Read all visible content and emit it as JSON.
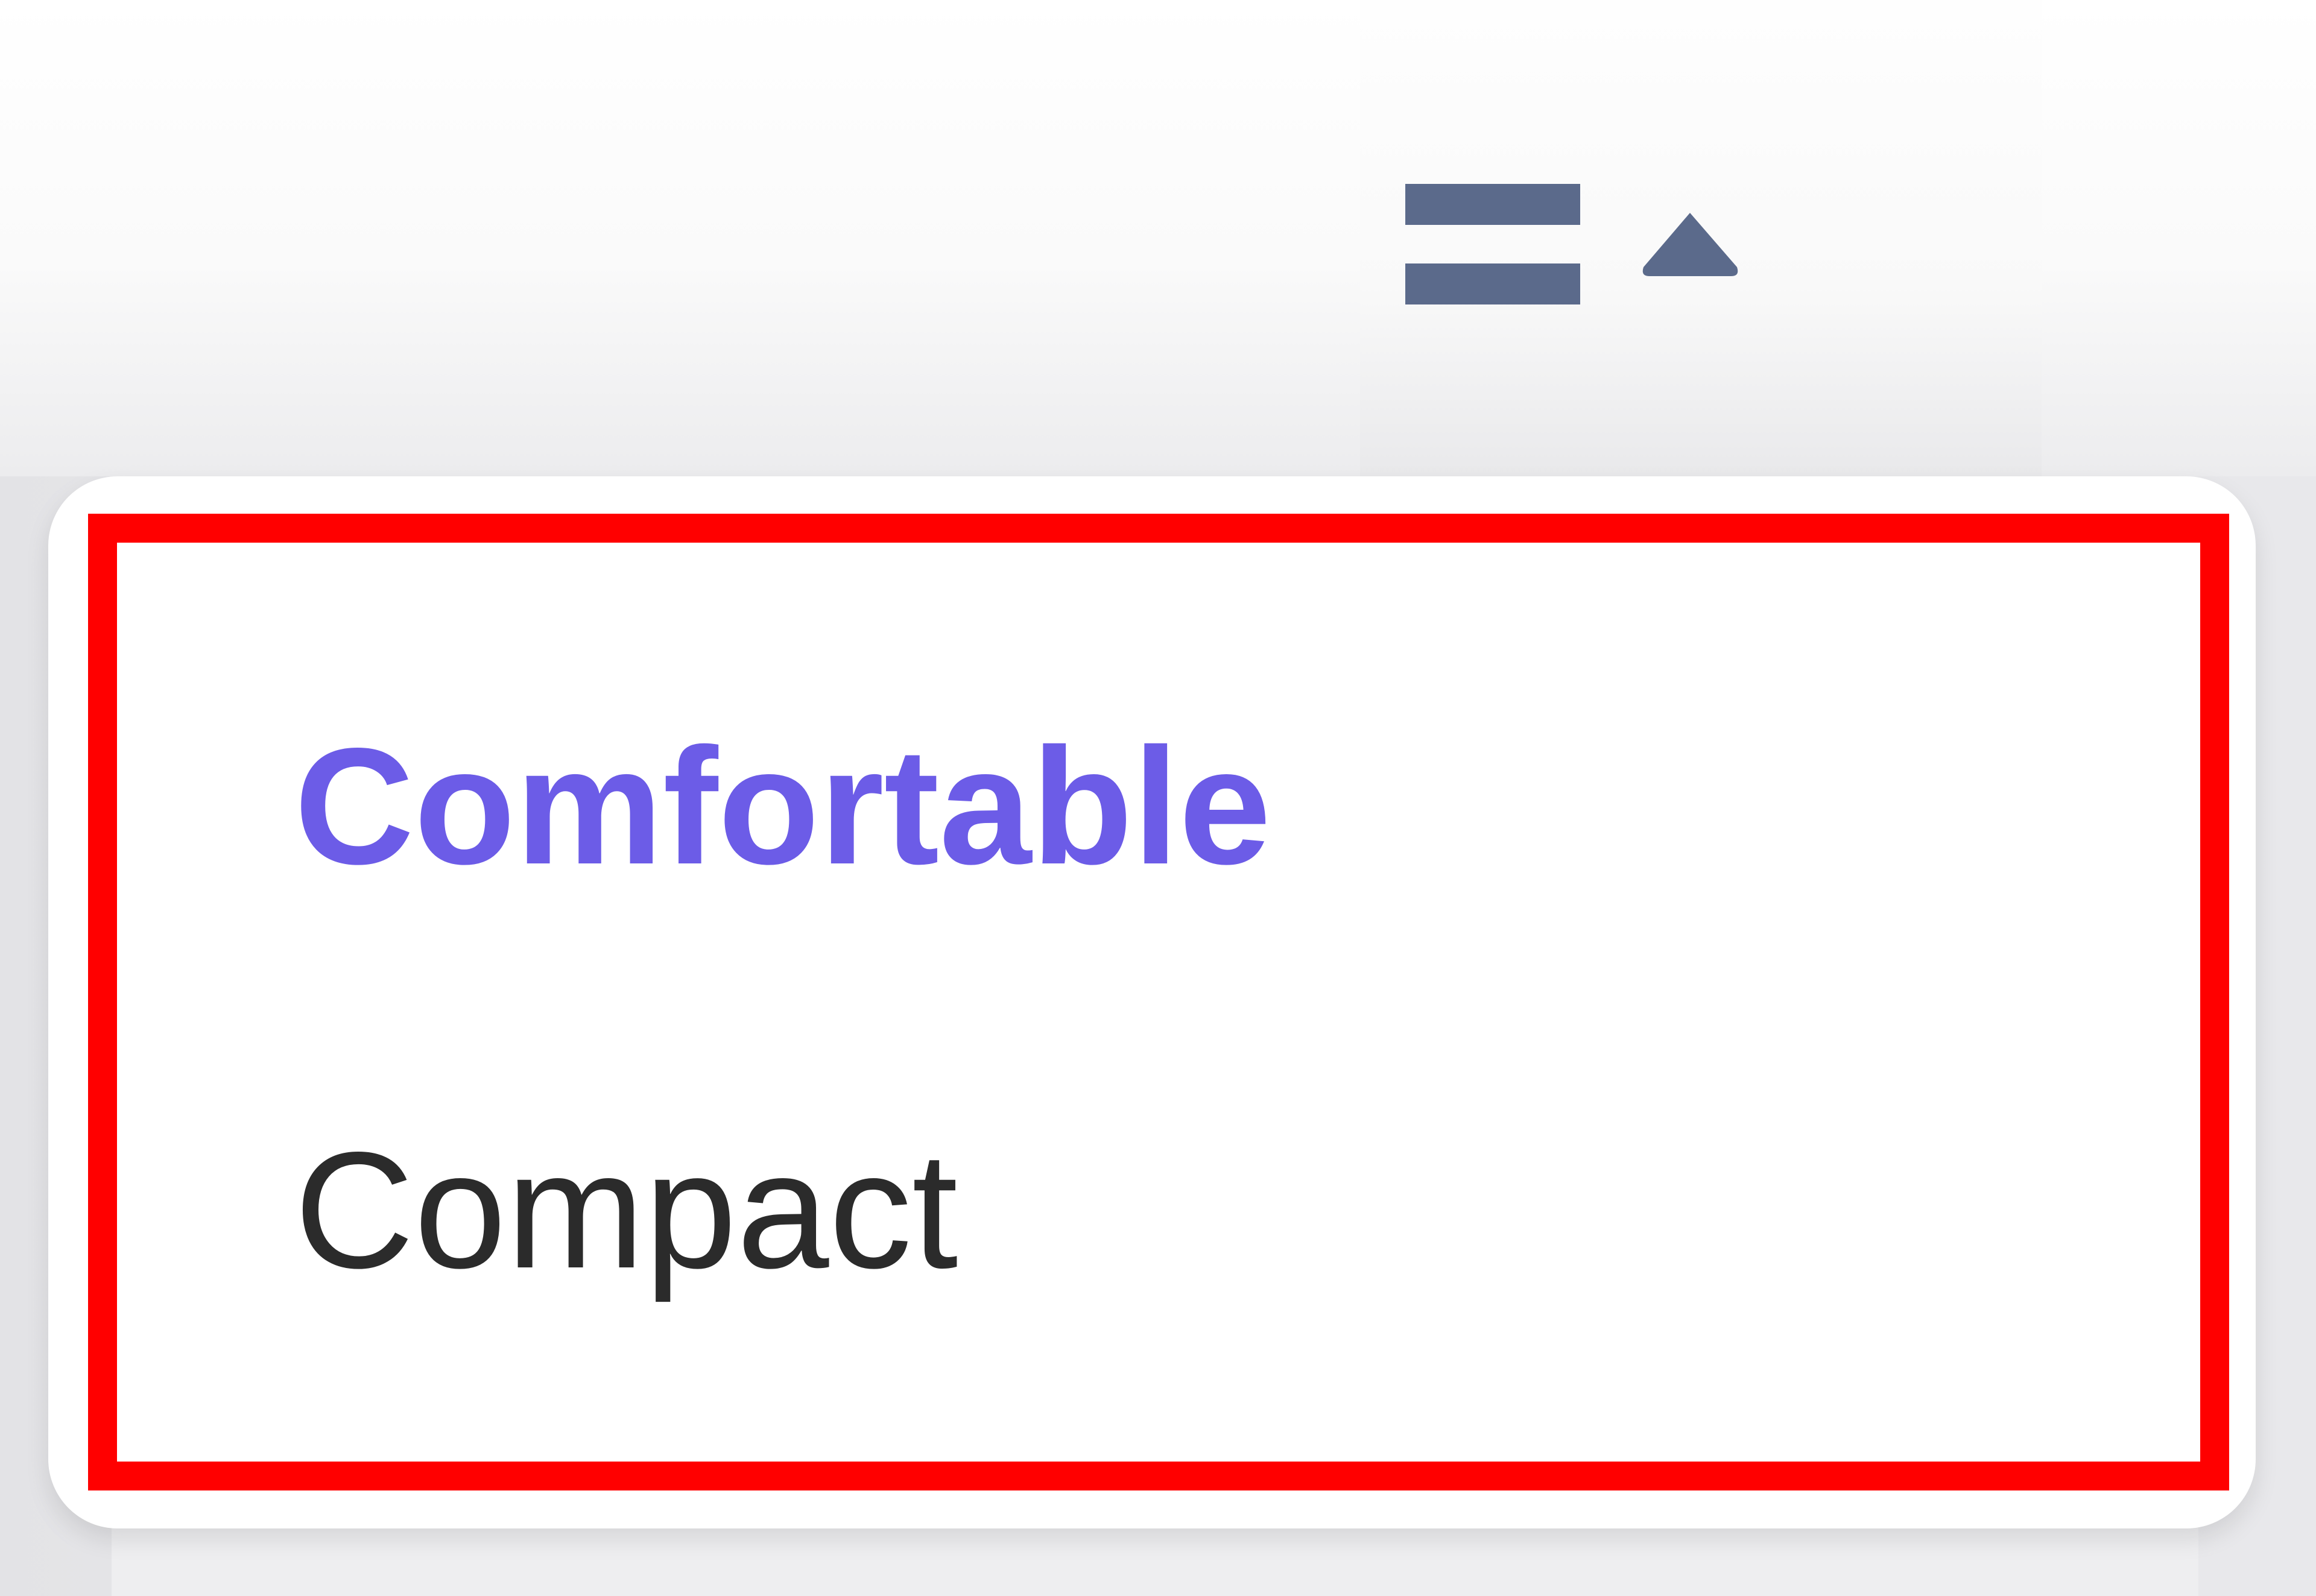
{
  "toolbar": {
    "density_toggle": {
      "icon": "rows-icon",
      "caret": "caret-up-icon",
      "expanded": true
    }
  },
  "density_menu": {
    "items": [
      {
        "label": "Comfortable",
        "selected": true
      },
      {
        "label": "Compact",
        "selected": false
      }
    ]
  },
  "colors": {
    "selected_item": "#6c5ce7",
    "item_text": "#2b2b2b",
    "icon": "#5b6a8b",
    "highlight_border": "#ff0000"
  }
}
